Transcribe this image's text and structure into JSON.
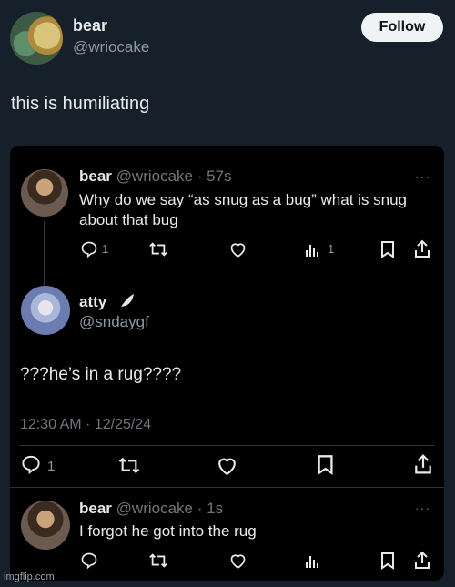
{
  "author": {
    "name": "bear",
    "handle": "@wriocake"
  },
  "follow_label": "Follow",
  "post_text": "this is humiliating",
  "embedded": {
    "tweet1": {
      "name": "bear",
      "handle": "@wriocake",
      "separator": "·",
      "time": "57s",
      "text_line1": "Why do we say “as snug as a bug” what is snug",
      "text_line2": "about that bug",
      "reply_count": "1",
      "views_count": "1",
      "more": "···"
    },
    "tweet2": {
      "name": "atty",
      "handle": "@sndaygf",
      "text": "???he’s in a rug????",
      "timestamp": "12:30 AM · 12/25/24",
      "reply_count": "1"
    },
    "tweet3": {
      "name": "bear",
      "handle": "@wriocake",
      "separator": "·",
      "time": "1s",
      "text": "I forgot he got into the rug",
      "more": "···"
    }
  },
  "icons": {
    "reply": "reply-icon",
    "retweet": "retweet-icon",
    "like": "like-icon",
    "views": "views-icon",
    "bookmark": "bookmark-icon",
    "share": "share-icon"
  },
  "watermark": "imgflip.com",
  "colors": {
    "background": "#15202b",
    "card": "#000000",
    "text": "#e7e9ea",
    "muted": "#8b98a5",
    "follow_bg": "#eff3f4"
  }
}
